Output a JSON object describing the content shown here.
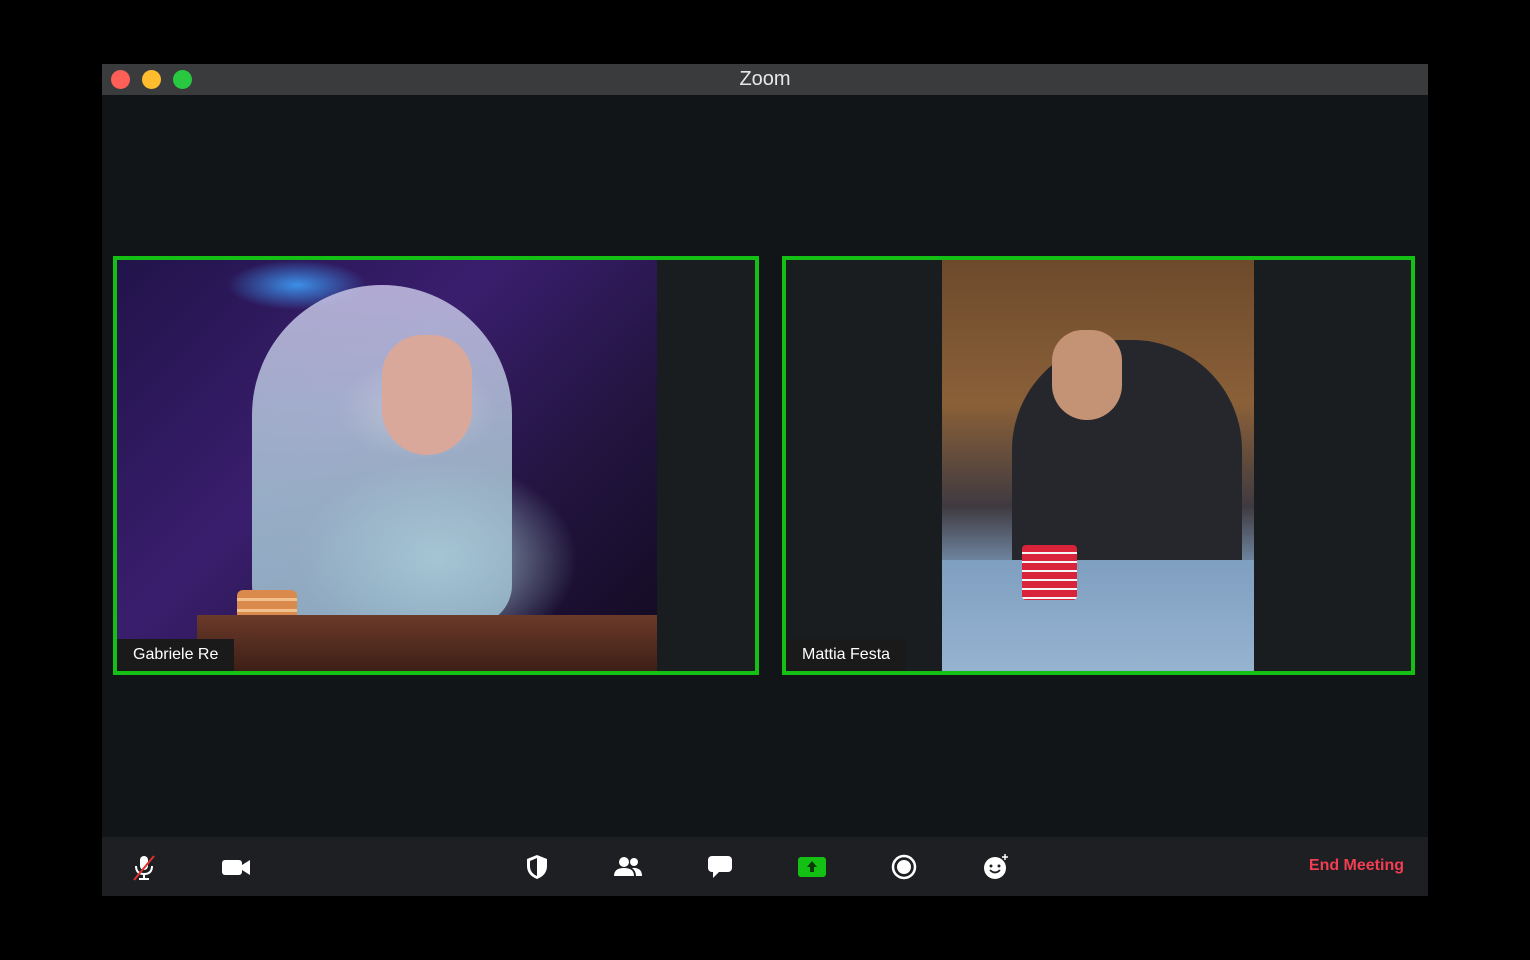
{
  "window": {
    "title": "Zoom"
  },
  "participants": [
    {
      "name": "Gabriele Re"
    },
    {
      "name": "Mattia Festa"
    }
  ],
  "toolbar": {
    "icons": [
      "mic-muted-icon",
      "video-camera-icon",
      "security-shield-icon",
      "participants-icon",
      "chat-icon",
      "share-screen-icon",
      "record-icon",
      "reactions-icon"
    ],
    "end_meeting_label": "End Meeting"
  },
  "colors": {
    "active_speaker_border": "#13c013",
    "share_button": "#13c013",
    "end_meeting": "#f23d52"
  }
}
